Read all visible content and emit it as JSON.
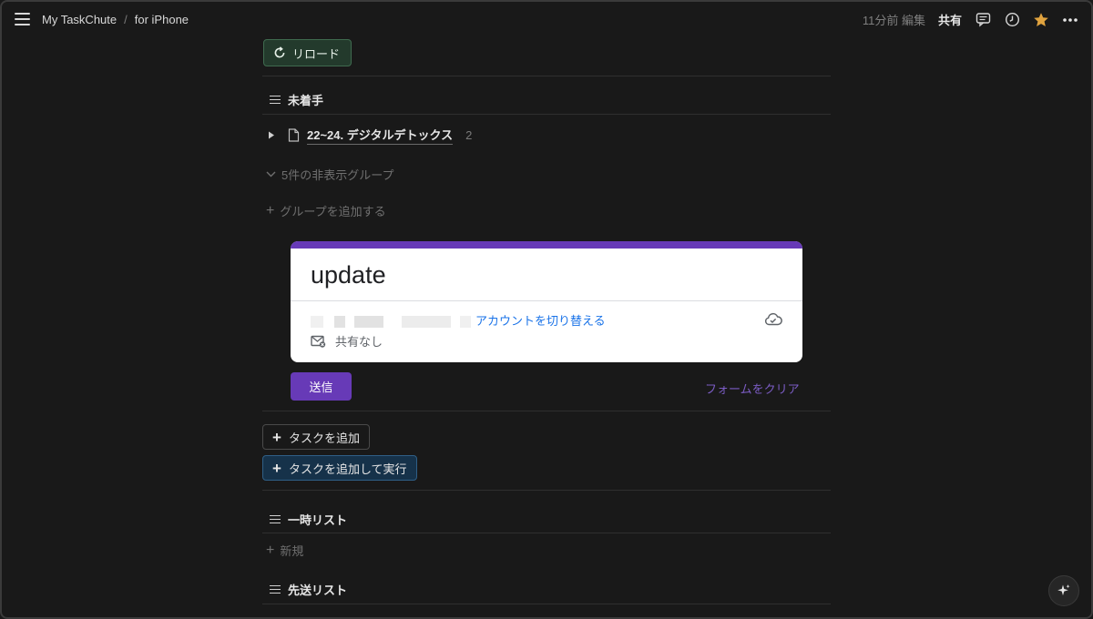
{
  "topbar": {
    "breadcrumb": [
      "My TaskChute",
      "for iPhone"
    ],
    "edited": "11分前 編集",
    "share": "共有"
  },
  "reload": {
    "label": "リロード"
  },
  "sections": {
    "untouched": "未着手",
    "temp_list": "一時リスト",
    "postpone_list": "先送リスト"
  },
  "task": {
    "title": "22~24. デジタルデトックス",
    "count": "2"
  },
  "hidden_groups": "5件の非表示グループ",
  "add_group": "グループを追加する",
  "form": {
    "title": "update",
    "switch_account": "アカウントを切り替える",
    "not_shared": "共有なし",
    "submit": "送信",
    "clear": "フォームをクリア",
    "accent": "#673ab7"
  },
  "buttons": {
    "add_task": "タスクを追加",
    "add_and_run": "タスクを追加して実行"
  },
  "new_item": "新規"
}
